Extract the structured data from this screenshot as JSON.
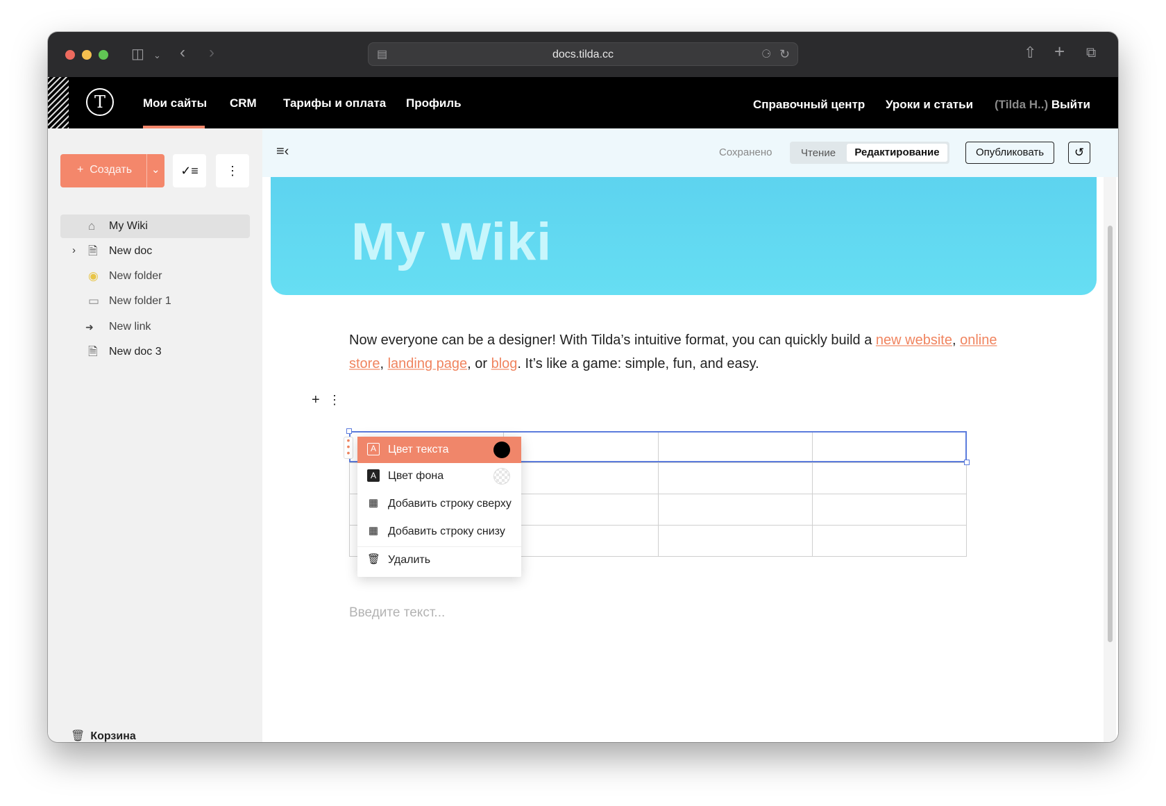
{
  "browser": {
    "url": "docs.tilda.cc"
  },
  "topnav": {
    "left": [
      "Мои сайты",
      "CRM",
      "Тарифы и оплата",
      "Профиль"
    ],
    "right": [
      "Справочный центр",
      "Уроки и статьи"
    ],
    "user": "(Tilda H..)",
    "logout": "Выйти"
  },
  "sidebar": {
    "create_label": "Создать",
    "items": [
      {
        "label": "My Wiki",
        "icon": "home-icon"
      },
      {
        "label": "New doc",
        "icon": "document-icon"
      },
      {
        "label": "New folder",
        "icon": "lightbulb-icon"
      },
      {
        "label": "New folder 1",
        "icon": "folder-icon"
      },
      {
        "label": "New link",
        "icon": "soon-arrow-icon"
      },
      {
        "label": "New doc 3",
        "icon": "document-lock-icon"
      }
    ],
    "trash": "Корзина"
  },
  "toolbar": {
    "status": "Сохранено",
    "mode_read": "Чтение",
    "mode_edit": "Редактирование",
    "publish": "Опубликовать"
  },
  "page": {
    "title": "My Wiki",
    "intro_before": "Now everyone can be a designer! With Tilda’s intuitive format, you can quickly build a ",
    "link_new_website": "new website",
    "sep1": ", ",
    "link_online_store": "online store",
    "sep2": ", ",
    "link_landing_page": "landing page",
    "sep3": ", or ",
    "link_blog": "blog",
    "intro_after": ". It’s like a game: simple, fun, and easy.",
    "placeholder": "Введите текст..."
  },
  "context_menu": {
    "items": [
      {
        "label": "Цвет текста",
        "icon": "text-color-icon"
      },
      {
        "label": "Цвет фона",
        "icon": "background-color-icon"
      },
      {
        "label": "Добавить строку сверху",
        "icon": "table-row-above-icon"
      },
      {
        "label": "Добавить строку снизу",
        "icon": "table-row-below-icon"
      },
      {
        "label": "Удалить",
        "icon": "trash-icon"
      }
    ]
  },
  "colors": {
    "accent": "#f4876b",
    "cover": "#5dd3ef",
    "link": "#f0845f",
    "selection": "#5b7bdc"
  }
}
